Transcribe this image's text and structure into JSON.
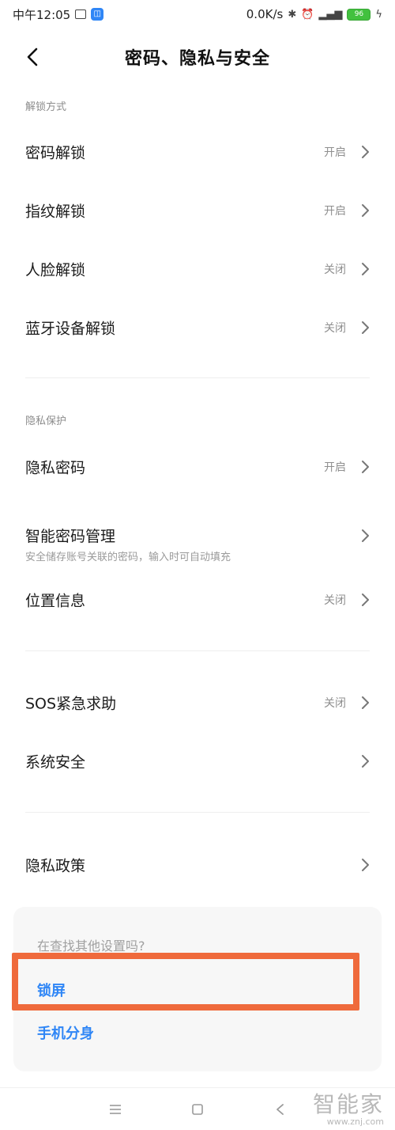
{
  "status_bar": {
    "time": "中午12:05",
    "network_speed": "0.0K/s",
    "battery": "96"
  },
  "header": {
    "title": "密码、隐私与安全"
  },
  "sections": {
    "unlock": {
      "label": "解锁方式",
      "items": [
        {
          "label": "密码解锁",
          "value": "开启"
        },
        {
          "label": "指纹解锁",
          "value": "开启"
        },
        {
          "label": "人脸解锁",
          "value": "关闭"
        },
        {
          "label": "蓝牙设备解锁",
          "value": "关闭"
        }
      ]
    },
    "privacy": {
      "label": "隐私保护",
      "items": [
        {
          "label": "隐私密码",
          "value": "开启"
        },
        {
          "label": "智能密码管理",
          "subtitle": "安全储存账号关联的密码，输入时可自动填充"
        },
        {
          "label": "位置信息",
          "value": "关闭"
        }
      ]
    },
    "other": {
      "items": [
        {
          "label": "SOS紧急求助",
          "value": "关闭"
        },
        {
          "label": "系统安全"
        },
        {
          "label": "隐私政策"
        }
      ]
    }
  },
  "suggestions": {
    "title": "在查找其他设置吗?",
    "links": [
      "锁屏",
      "手机分身"
    ]
  },
  "watermark": {
    "big": "智能家",
    "small": "www.znj.com"
  },
  "colors": {
    "accent": "#2f86f6",
    "highlight": "#ef6a3c",
    "battery": "#42c13f"
  }
}
